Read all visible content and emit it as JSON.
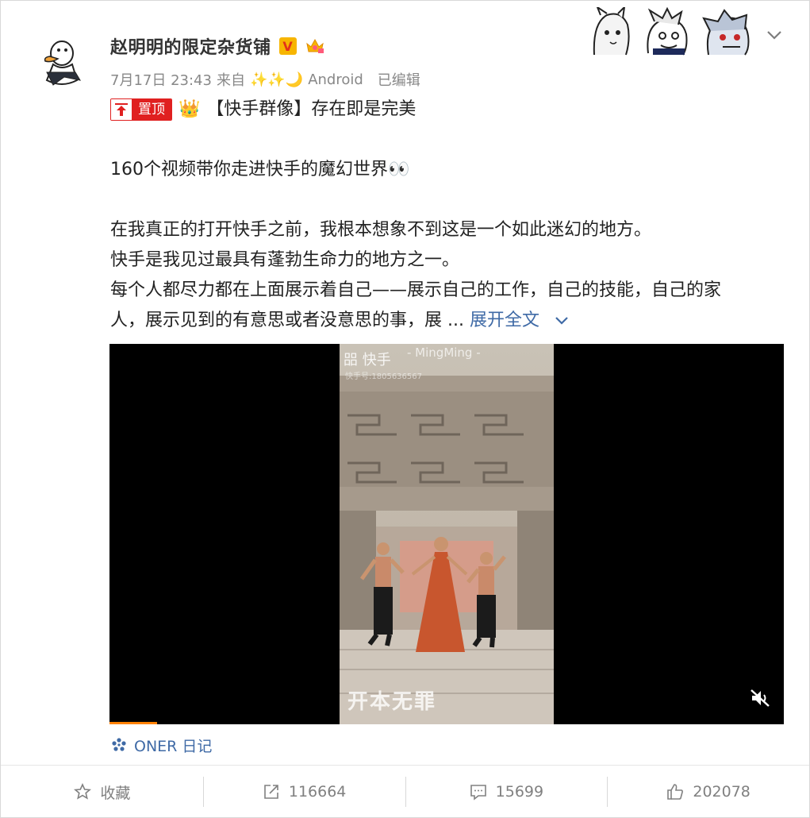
{
  "post": {
    "username": "赵明明的限定杂货铺",
    "verified_label": "V",
    "meta": {
      "date": "7月17日 23:43",
      "from": "来自",
      "source_prefix": "✨✨🌙",
      "source": "Android",
      "edited": "已编辑"
    },
    "pinned_label": "置顶",
    "title_emoji": "👑",
    "title": "【快手群像】存在即是完美",
    "line1": "160个视频带你走进快手的魔幻世界👀",
    "line2": "在我真正的打开快手之前，我根本想象不到这是一个如此迷幻的地方。",
    "line3": "快手是我见过最具有蓬勃生命力的地方之一。",
    "line4": "每个人都尽力都在上面展示着自己——展示自己的工作，自己的技能，自己的家",
    "line5": "人，展示见到的有意思或者没意思的事，展 ...",
    "expand": "展开全文",
    "video": {
      "watermark_app": "快手",
      "watermark_user": "- MingMing -",
      "watermark_id": "快手号:1805636567",
      "subtitle": "开本无罪",
      "progress": 0.07
    },
    "video_source": "ONER 日记"
  },
  "footer": {
    "favorite": "收藏",
    "reposts": "116664",
    "comments": "15699",
    "likes": "202078"
  },
  "colors": {
    "link": "#3f6aa6",
    "pinned": "#e02020",
    "progress": "#ff8200"
  }
}
